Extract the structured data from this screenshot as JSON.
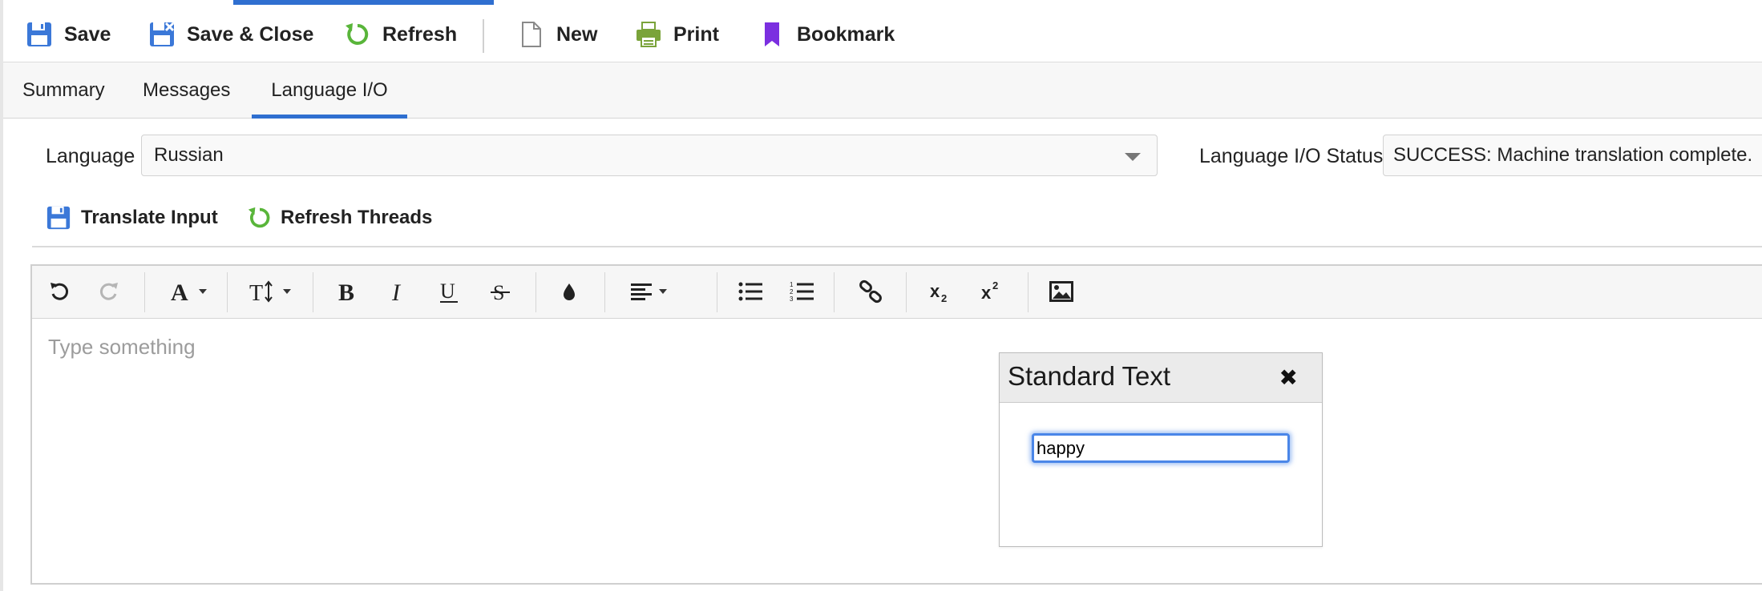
{
  "toolbar": {
    "save": "Save",
    "save_close": "Save & Close",
    "refresh": "Refresh",
    "new": "New",
    "print": "Print",
    "bookmark": "Bookmark"
  },
  "tabs": [
    {
      "label": "Summary",
      "active": false
    },
    {
      "label": "Messages",
      "active": false
    },
    {
      "label": "Language I/O",
      "active": true
    }
  ],
  "language": {
    "label": "Language",
    "value": "Russian"
  },
  "status": {
    "label": "Language I/O Status",
    "value": "SUCCESS: Machine translation complete."
  },
  "actions": {
    "translate_input": "Translate Input",
    "refresh_threads": "Refresh Threads"
  },
  "editor": {
    "placeholder": "Type something",
    "tools": [
      "undo-icon",
      "redo-icon",
      "font-family-icon",
      "font-size-icon",
      "bold-icon",
      "italic-icon",
      "underline-icon",
      "strikethrough-icon",
      "color-icon",
      "align-icon",
      "bullet-list-icon",
      "numbered-list-icon",
      "link-icon",
      "subscript-icon",
      "superscript-icon",
      "image-icon"
    ]
  },
  "popup": {
    "title": "Standard Text",
    "close_glyph": "✖",
    "input_value": "happy"
  },
  "colors": {
    "accent": "#2f6fd0",
    "save_blue": "#3b78d8",
    "refresh_green": "#59b53a",
    "print_green": "#7aa33a",
    "bookmark_purple": "#7b2fe0"
  }
}
